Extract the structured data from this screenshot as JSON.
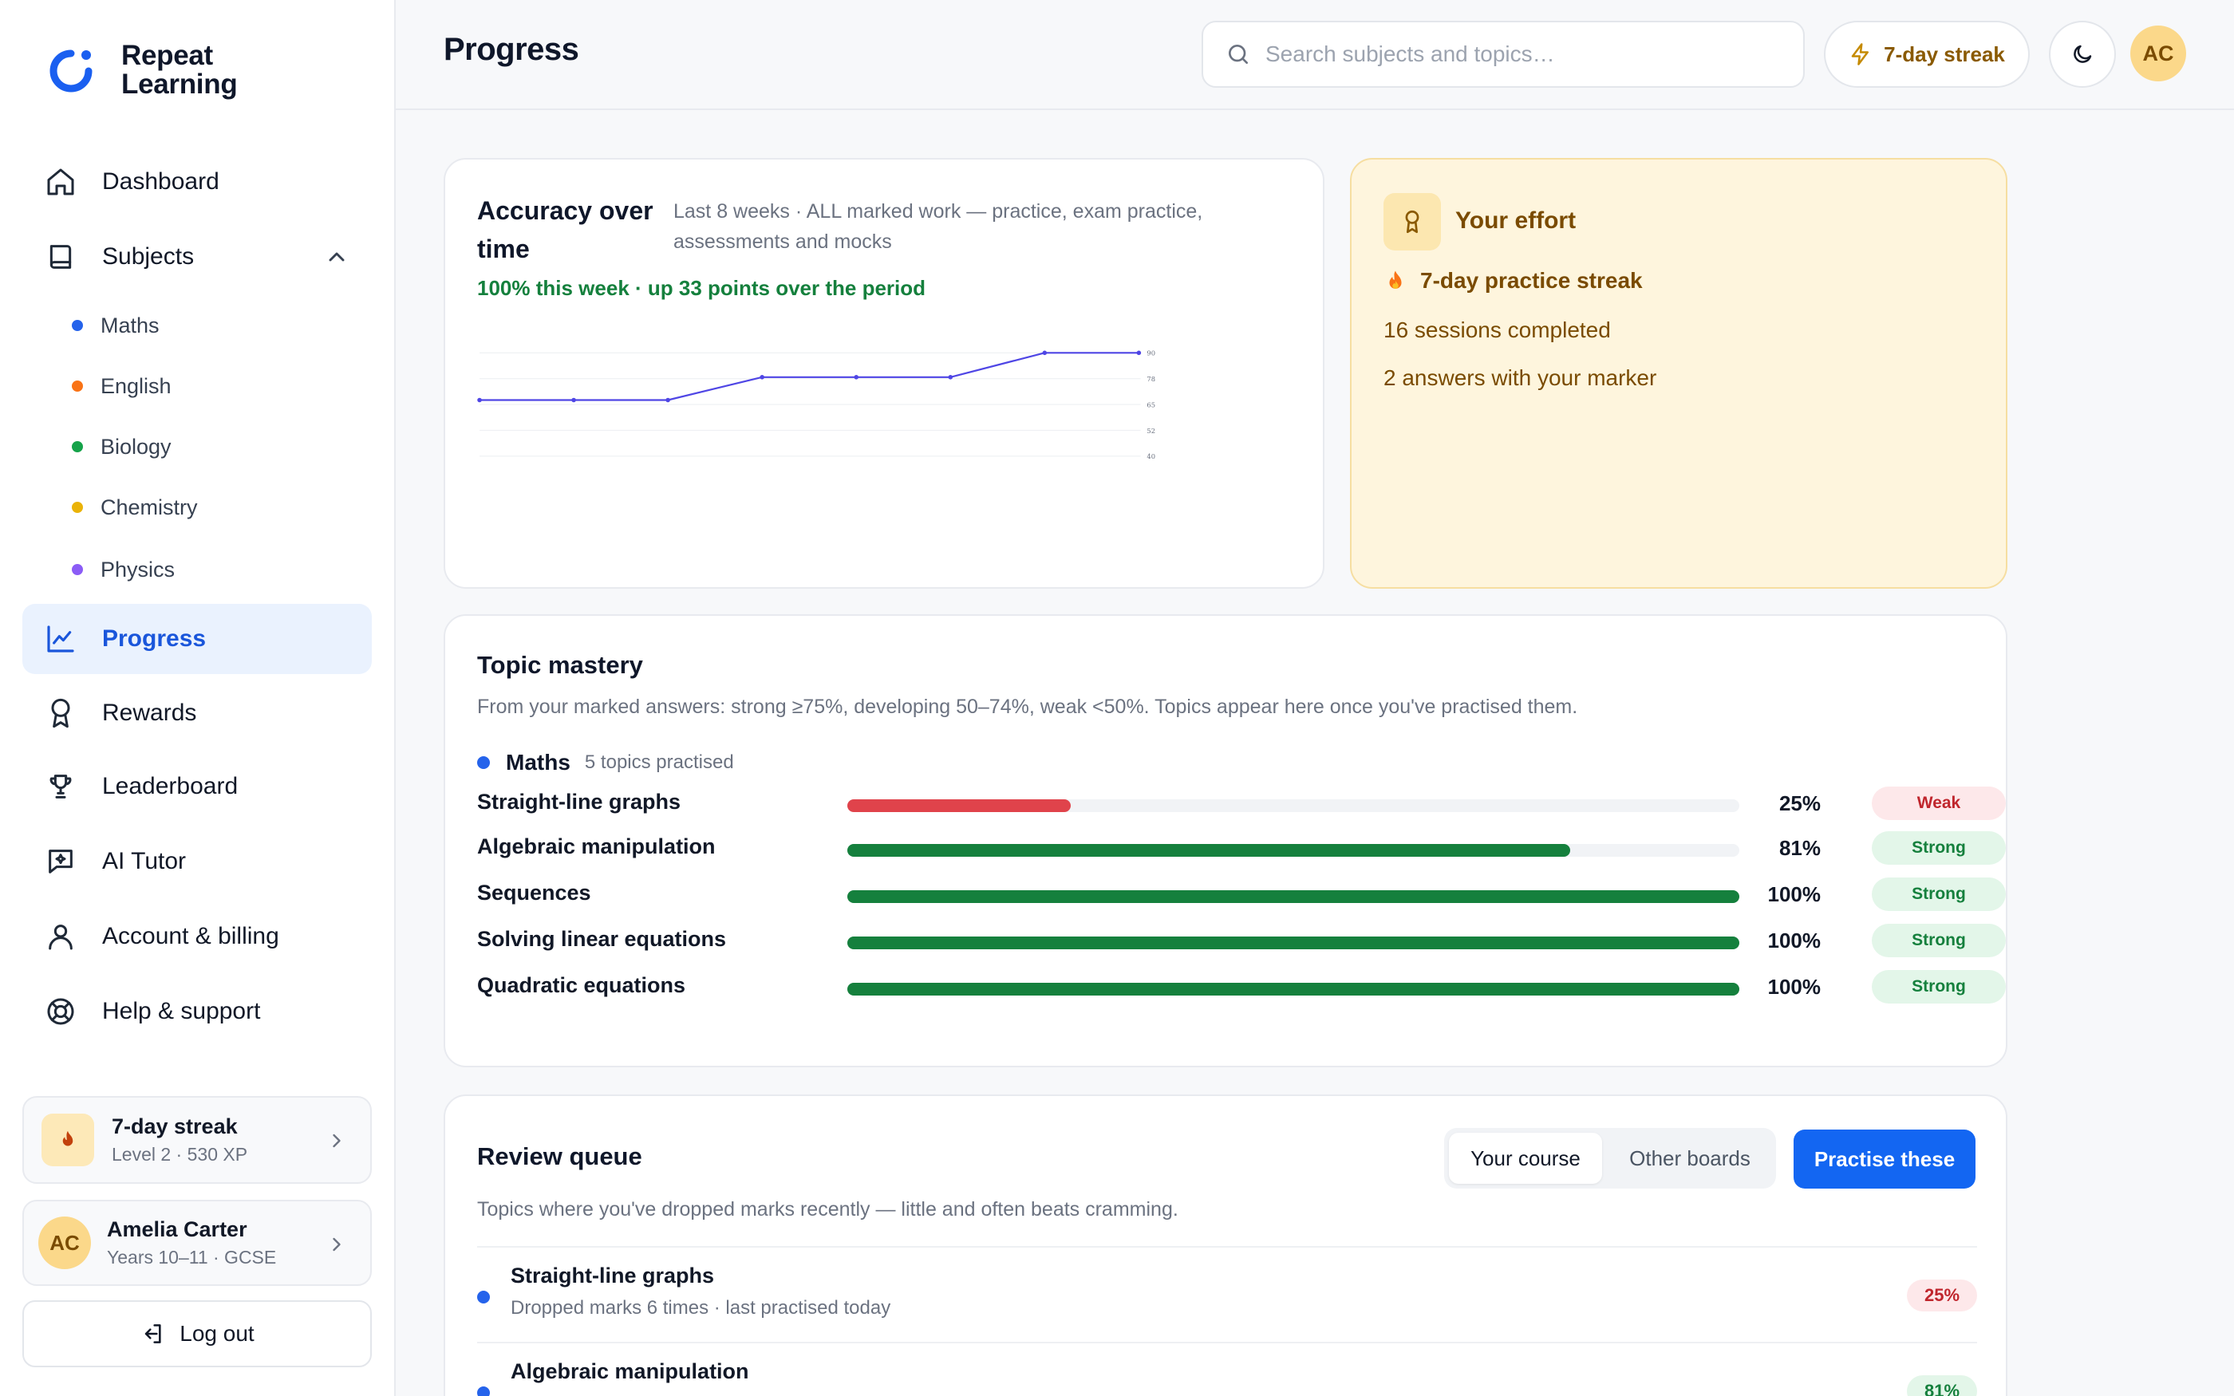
{
  "app": {
    "name_line1": "Repeat",
    "name_line2": "Learning"
  },
  "nav": {
    "dashboard": "Dashboard",
    "subjects": "Subjects",
    "subject_items": [
      {
        "label": "Maths",
        "color": "#2563eb"
      },
      {
        "label": "English",
        "color": "#f97316"
      },
      {
        "label": "Biology",
        "color": "#16a34a"
      },
      {
        "label": "Chemistry",
        "color": "#eab308"
      },
      {
        "label": "Physics",
        "color": "#8b5cf6"
      }
    ],
    "progress": "Progress",
    "rewards": "Rewards",
    "leaderboard": "Leaderboard",
    "ai_tutor": "AI Tutor",
    "account": "Account & billing",
    "help": "Help & support"
  },
  "sidebar_streak": {
    "title": "7-day streak",
    "sub": "Level 2 · 530 XP"
  },
  "user": {
    "initials": "AC",
    "name": "Amelia Carter",
    "sub": "Years 10–11 · GCSE"
  },
  "logout_label": "Log out",
  "header": {
    "title": "Progress",
    "search_placeholder": "Search subjects and topics…",
    "streak": "7-day streak",
    "avatar": "AC"
  },
  "accuracy": {
    "title": "Accuracy over time",
    "desc": "Last 8 weeks · ALL marked work — practice, exam practice, assessments and mocks",
    "note": "100% this week · up 33 points over the period"
  },
  "chart_data": {
    "type": "line",
    "x": [
      1,
      2,
      3,
      4,
      5,
      6,
      7,
      8
    ],
    "series": [
      {
        "values": [
          67,
          67,
          67,
          83,
          83,
          83,
          100,
          100
        ]
      }
    ],
    "yticks": [
      "90",
      "78",
      "65",
      "52",
      "40"
    ],
    "grid": true,
    "color": "#4f46e5"
  },
  "effort": {
    "title": "Your effort",
    "streak": "7-day practice streak",
    "sessions": "16 sessions completed",
    "marker": "2 answers with your marker"
  },
  "mastery": {
    "title": "Topic mastery",
    "desc": "From your marked answers: strong ≥75%, developing 50–74%, weak <50%. Topics appear here once you've practised them.",
    "subject": "Maths",
    "subject_count": "5 topics practised",
    "topics": [
      {
        "name": "Straight-line graphs",
        "value": 25,
        "pct": "25%",
        "status": "Weak"
      },
      {
        "name": "Algebraic manipulation",
        "value": 81,
        "pct": "81%",
        "status": "Strong"
      },
      {
        "name": "Sequences",
        "value": 100,
        "pct": "100%",
        "status": "Strong"
      },
      {
        "name": "Solving linear equations",
        "value": 100,
        "pct": "100%",
        "status": "Strong"
      },
      {
        "name": "Quadratic equations",
        "value": 100,
        "pct": "100%",
        "status": "Strong"
      }
    ]
  },
  "review": {
    "title": "Review queue",
    "tab_course": "Your course",
    "tab_other": "Other boards",
    "practise": "Practise these",
    "desc": "Topics where you've dropped marks recently — little and often beats cramming.",
    "items": [
      {
        "name": "Straight-line graphs",
        "sub": "Dropped marks 6 times · last practised today",
        "pct": "25%"
      },
      {
        "name": "Algebraic manipulation",
        "sub": "",
        "pct": "81%"
      }
    ]
  },
  "colors": {
    "accent": "#1a56db",
    "weak": "#e0434b",
    "strong": "#15803d",
    "line": "#4f46e5"
  }
}
